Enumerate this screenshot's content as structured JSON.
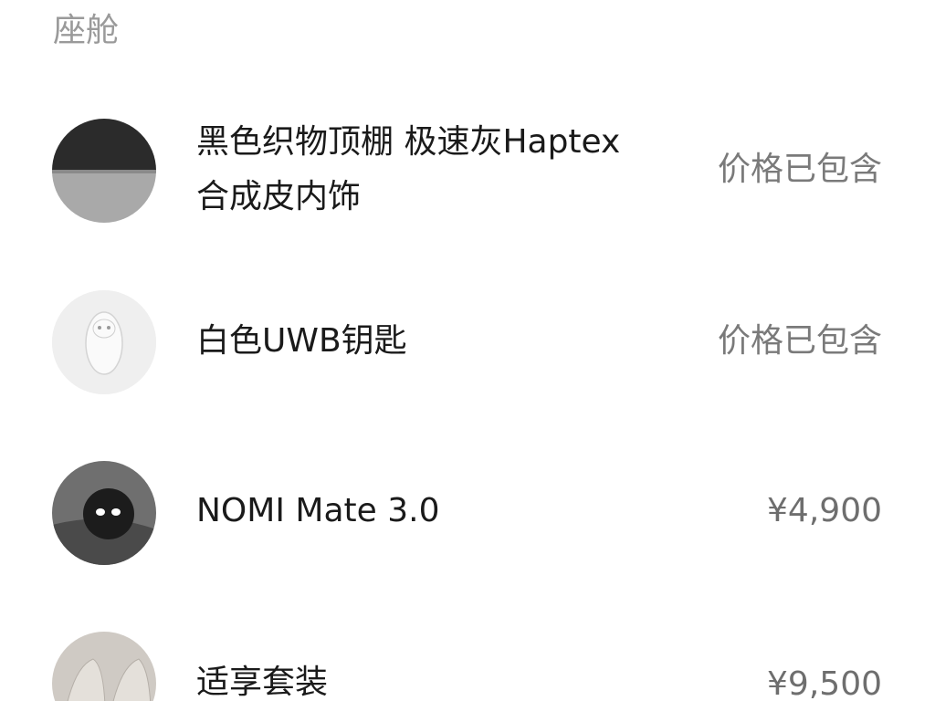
{
  "section": {
    "title": "座舱"
  },
  "items": [
    {
      "name_line1": "黑色织物顶棚 极速灰Haptex",
      "name_line2": "合成皮内饰",
      "price": "价格已包含",
      "icon": "interior-material-swatch"
    },
    {
      "name": "白色UWB钥匙",
      "price": "价格已包含",
      "icon": "uwb-key-fob"
    },
    {
      "name": "NOMI Mate 3.0",
      "price": "¥4,900",
      "icon": "nomi-robot"
    },
    {
      "name": "适享套装",
      "price": "¥9,500",
      "icon": "seat-package"
    }
  ],
  "colors": {
    "title": "#9a9a9a",
    "text": "#1a1a1a",
    "price": "#7a7a7a",
    "background": "#ffffff"
  }
}
